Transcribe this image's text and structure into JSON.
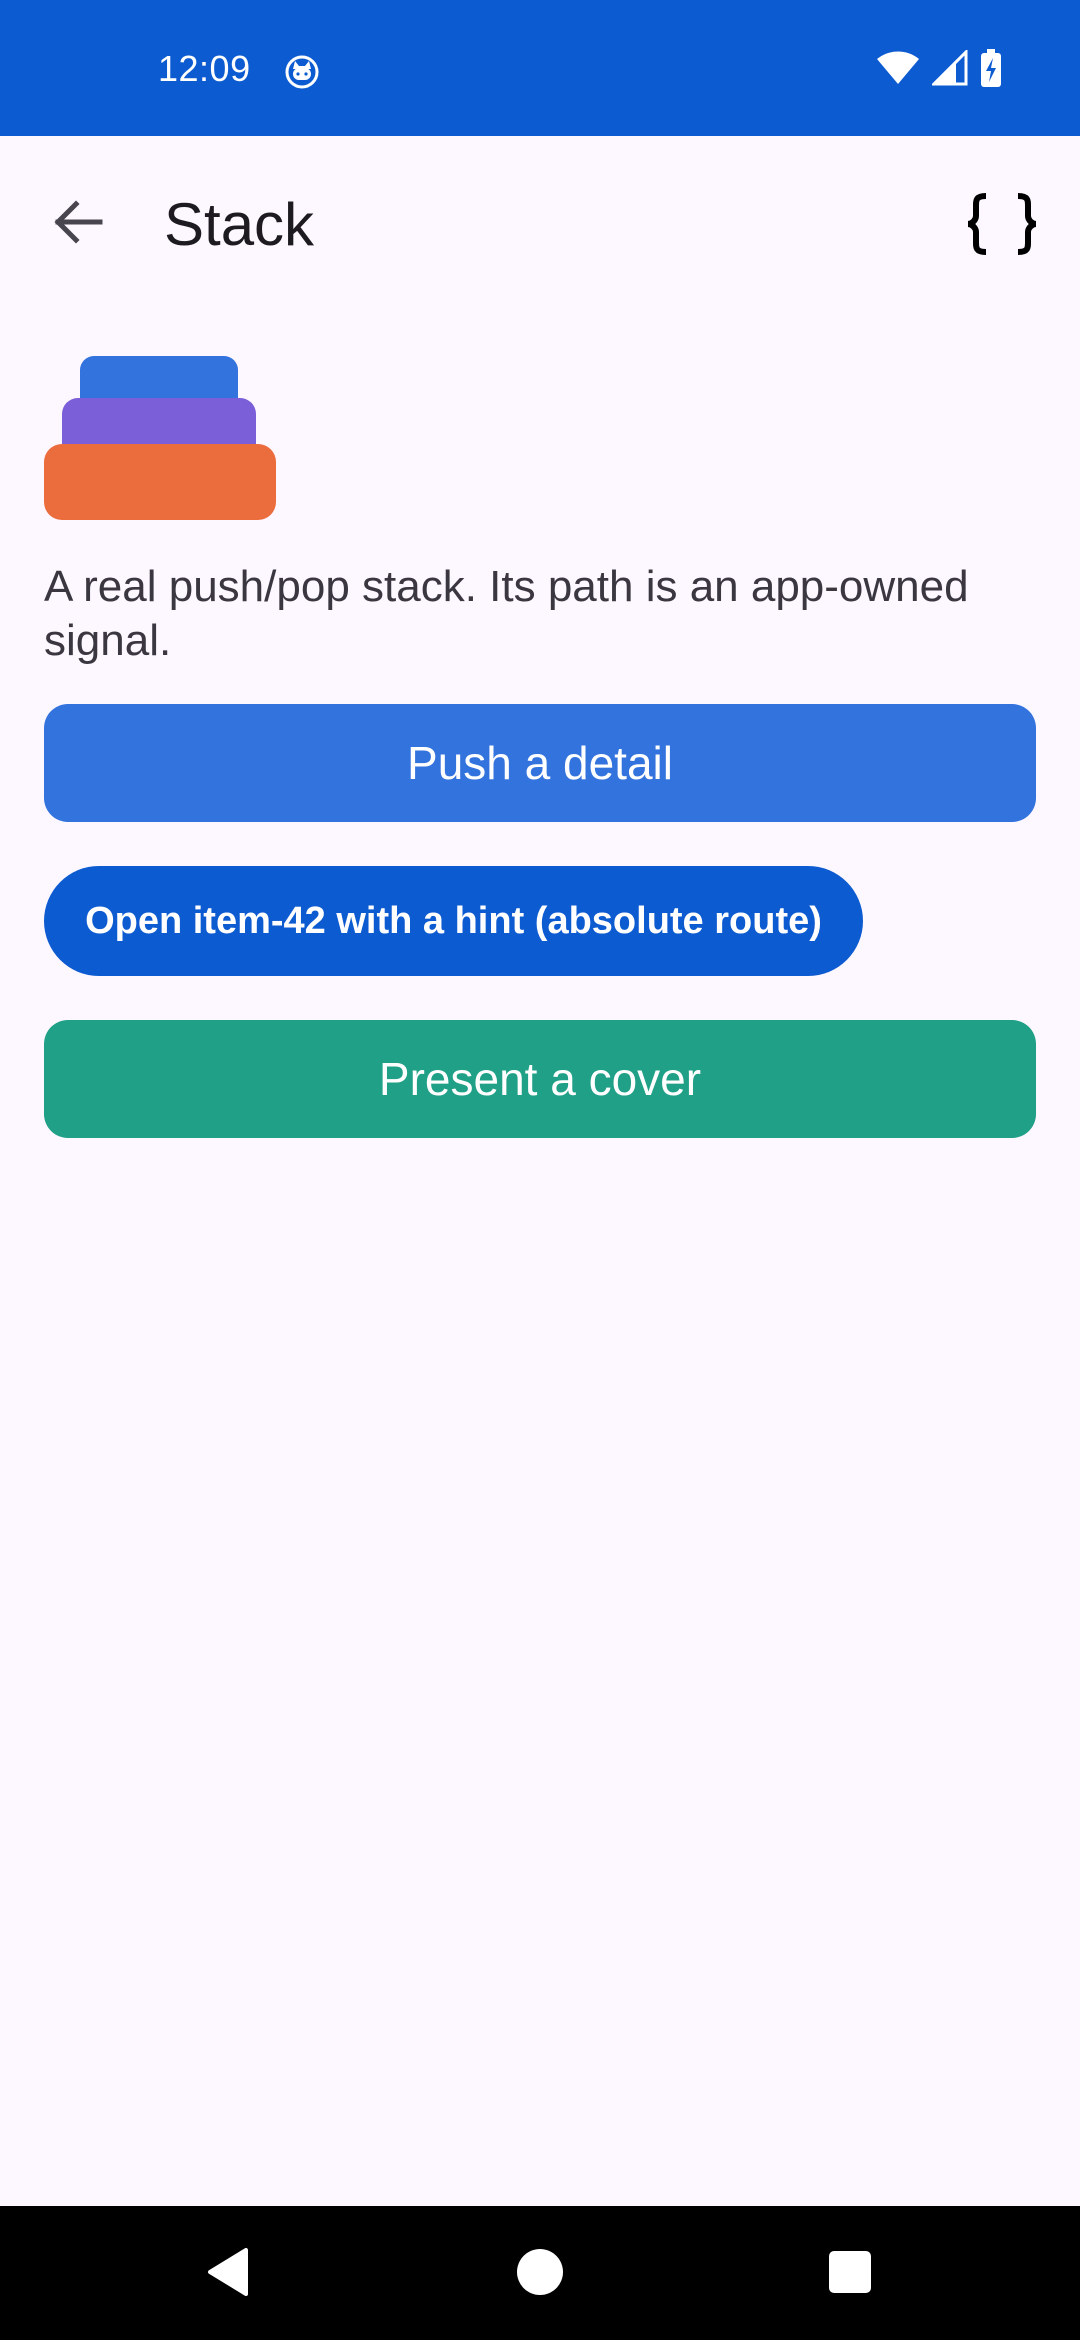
{
  "status_bar": {
    "time": "12:09",
    "app_icon": "cat-face-icon",
    "wifi_icon": "wifi-icon",
    "signal_icon": "cell-signal-icon",
    "battery_icon": "battery-charging-icon",
    "background_color": "#0D5BD1"
  },
  "app_bar": {
    "title": "Stack",
    "back_icon": "arrow-back-icon",
    "action_icon": "code-braces-icon"
  },
  "illustration": {
    "name": "stack-illustration",
    "layer_colors": [
      "#3373DE",
      "#7B5FD8",
      "#EB6D3E"
    ]
  },
  "main": {
    "description": "A real push/pop stack. Its path is an app-owned signal.",
    "buttons": {
      "push_label": "Push a detail",
      "open_label": "Open item-42 with a hint (absolute route)",
      "cover_label": "Present a cover"
    }
  },
  "colors": {
    "page_background": "#FDF7FF",
    "push_button": "#3373DE",
    "open_button": "#0D5BD1",
    "cover_button": "#1FA087"
  },
  "nav_bar": {
    "back_icon": "nav-back-triangle-icon",
    "home_icon": "nav-home-circle-icon",
    "recents_icon": "nav-recents-square-icon"
  }
}
